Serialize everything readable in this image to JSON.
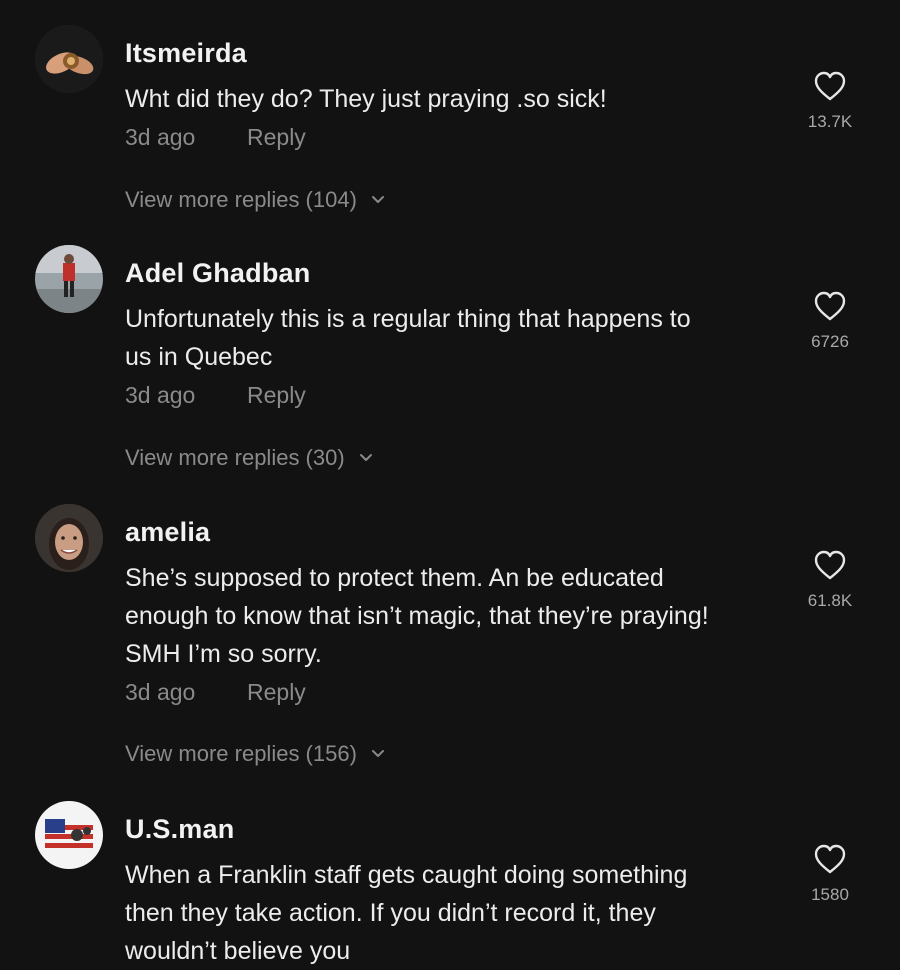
{
  "comments": [
    {
      "username": "Itsmeirda",
      "lines": [
        "Wht did they do? They just praying .so sick!"
      ],
      "time": "3d ago",
      "reply_label": "Reply",
      "likes": "13.7K",
      "more_replies": "View more replies (104)"
    },
    {
      "username": "Adel Ghadban",
      "lines": [
        "Unfortunately this is a regular thing that happens to",
        "us in Quebec"
      ],
      "time": "3d ago",
      "reply_label": "Reply",
      "likes": "6726",
      "more_replies": "View more replies (30)"
    },
    {
      "username": "amelia",
      "lines": [
        "She’s supposed to protect them. An be educated",
        "enough to know that isn’t magic, that they’re praying!",
        "SMH I’m so sorry."
      ],
      "time": "3d ago",
      "reply_label": "Reply",
      "likes": "61.8K",
      "more_replies": "View more replies (156)"
    },
    {
      "username": "U.S.man",
      "lines": [
        "When a Franklin staff gets caught doing something",
        "then they take action. If you didn’t record it, they",
        "wouldn’t believe you"
      ],
      "likes": "1580"
    }
  ],
  "icons": {
    "like": "heart-outline-icon",
    "expand": "chevron-down-icon"
  },
  "colors": {
    "background": "#121212",
    "username": "#f2f2f2",
    "body_text": "#ececec",
    "muted": "#8a8a8a"
  }
}
